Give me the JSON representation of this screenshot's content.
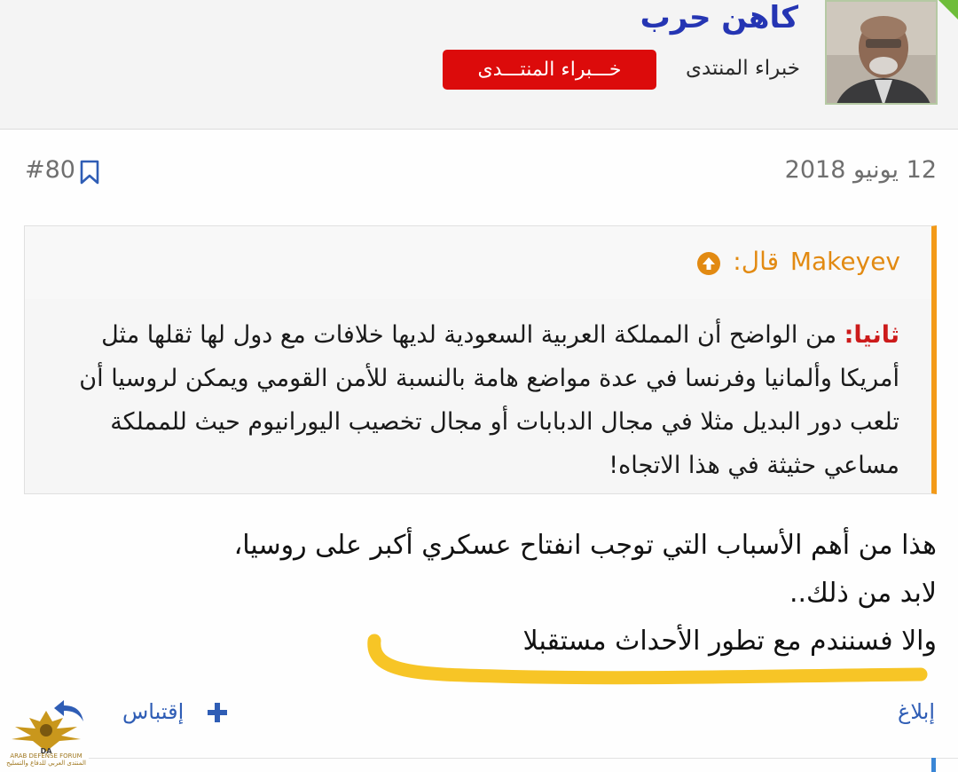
{
  "header": {
    "username": "كاهن حرب",
    "user_title": "خبراء المنتدى",
    "badge": "خـــبراء المنتـــدى",
    "colors": {
      "username": "#2535b3",
      "badge": "#dc0b0b"
    }
  },
  "post": {
    "date": "12 يونيو 2018",
    "number": "#80",
    "quote": {
      "author": "Makeyev",
      "said": "قال:",
      "lead": "ثانيا:",
      "text": " من الواضح أن المملكة العربية السعودية لديها خلافات مع دول لها ثقلها مثل أمريكا وألمانيا وفرنسا في عدة مواضع هامة بالنسبة للأمن القومي ويمكن لروسيا أن تلعب دور البديل مثلا في مجال الدبابات أو مجال تخصيب اليورانيوم حيث للمملكة مساعي حثيثة في هذا الاتجاه!",
      "accent": "#f39a18"
    },
    "body": [
      "هذا من أهم الأسباب التي توجب انفتاح عسكري أكبر على روسيا،",
      "لابد من ذلك..",
      "والا فسنندم مع تطور الأحداث مستقبلا"
    ],
    "highlight_color": "#f7c21a"
  },
  "actions": {
    "report": "إبلاغ",
    "quote": "إقتباس"
  },
  "watermark": {
    "line1": "ARAB DEFENSE FORUM",
    "line2": "المنتدى العربي للدفاع والتسليح"
  },
  "icons": [
    "bookmark-icon",
    "arrow-up-icon",
    "plus-icon",
    "reply-arrow-icon"
  ]
}
